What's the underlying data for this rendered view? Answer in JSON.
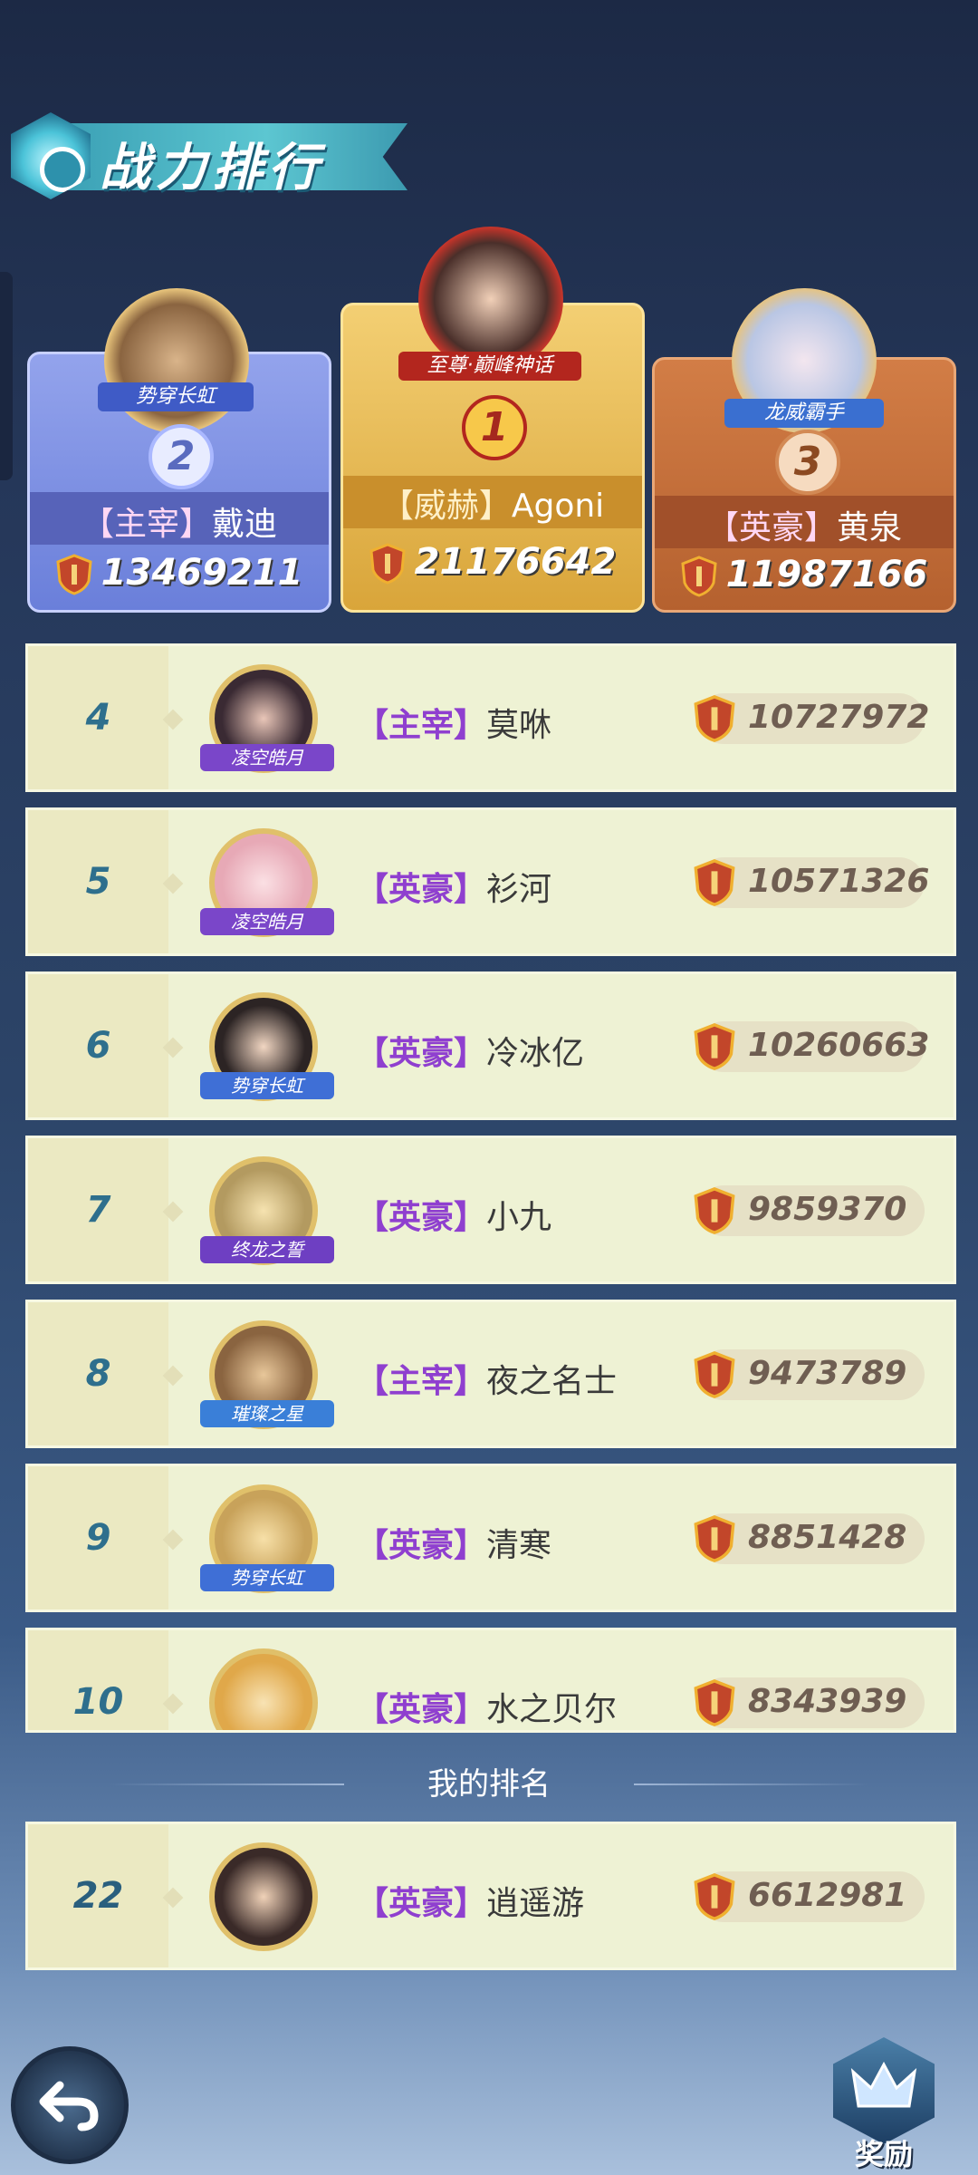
{
  "header": {
    "title": "战力排行"
  },
  "podium": [
    {
      "rank": "2",
      "title": "势穿长虹",
      "tag": "【主宰】",
      "name": "戴迪",
      "score": "13469211",
      "color": "#6b7fd6"
    },
    {
      "rank": "1",
      "title": "至尊·巅峰神话",
      "tag": "【威赫】",
      "name": "Agoni",
      "score": "21176642",
      "color": "#d9a53a"
    },
    {
      "rank": "3",
      "title": "龙威霸手",
      "tag": "【英豪】",
      "name": "黄泉",
      "score": "11987166",
      "color": "#bd6a36"
    }
  ],
  "rows": [
    {
      "rank": "4",
      "title": "凌空皓月",
      "tag": "【主宰】",
      "name": "莫咻",
      "score": "10727972"
    },
    {
      "rank": "5",
      "title": "凌空皓月",
      "tag": "【英豪】",
      "name": "衫河",
      "score": "10571326"
    },
    {
      "rank": "6",
      "title": "势穿长虹",
      "tag": "【英豪】",
      "name": "冷冰亿",
      "score": "10260663"
    },
    {
      "rank": "7",
      "title": "终龙之誓",
      "tag": "【英豪】",
      "name": "小九",
      "score": "9859370"
    },
    {
      "rank": "8",
      "title": "璀璨之星",
      "tag": "【主宰】",
      "name": "夜之名士",
      "score": "9473789"
    },
    {
      "rank": "9",
      "title": "势穿长虹",
      "tag": "【英豪】",
      "name": "清寒",
      "score": "8851428"
    },
    {
      "rank": "10",
      "title": "",
      "tag": "【英豪】",
      "name": "水之贝尔",
      "score": "8343939"
    }
  ],
  "my_rank": {
    "heading": "我的排名",
    "rank": "22",
    "tag": "【英豪】",
    "name": "逍遥游",
    "score": "6612981"
  },
  "buttons": {
    "back_icon": "back-arrow-icon",
    "reward_label": "奖励"
  }
}
